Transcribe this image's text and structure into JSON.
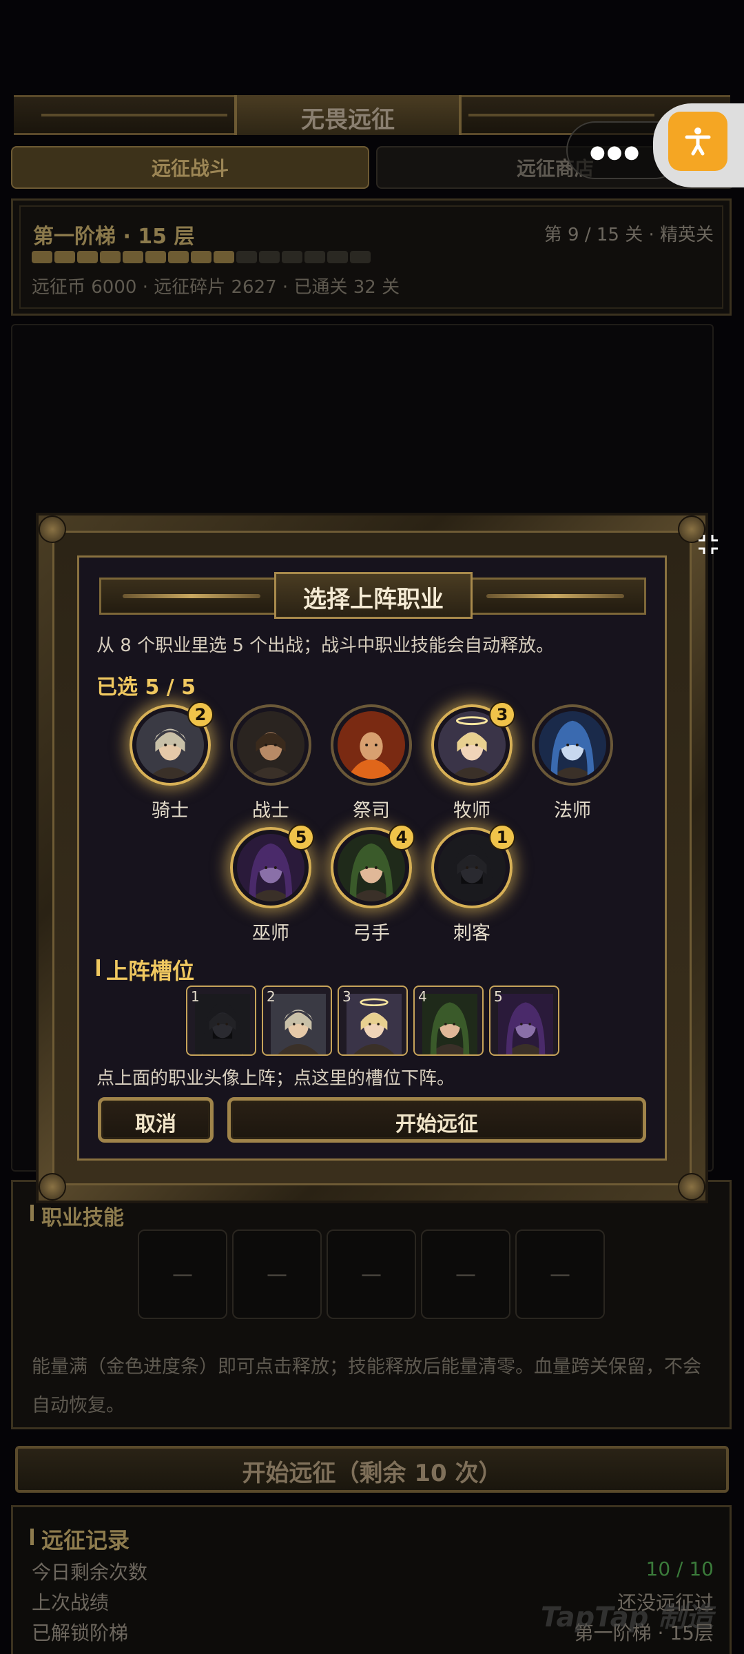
{
  "header": {
    "title": "无畏远征"
  },
  "tabs": [
    {
      "label": "远征战斗"
    },
    {
      "label": "远征商店"
    }
  ],
  "tier": {
    "title": "第一阶梯 · 15 层",
    "stage": "第 9 / 15 关 · 精英关",
    "progress_total": 15,
    "progress_done": 9,
    "meta": "远征币 6000 · 远征碎片 2627 · 已通关 32 关"
  },
  "skills": {
    "heading": "职业技能",
    "slots": [
      "—",
      "—",
      "—",
      "—",
      "—"
    ],
    "description": "能量满（金色进度条）即可点击释放；技能释放后能量清零。血量跨关保留，不会自动恢复。"
  },
  "start_button": {
    "label": "开始远征（剩余 10 次）"
  },
  "records": {
    "heading": "远征记录",
    "rows": [
      {
        "label": "今日剩余次数",
        "value": "10 / 10"
      },
      {
        "label": "上次战绩",
        "value": "还没远征过"
      },
      {
        "label": "已解锁阶梯",
        "value": "第一阶梯 · 15层"
      }
    ]
  },
  "watermark": "TapTap 制造",
  "modal": {
    "title": "选择上阵职业",
    "description": "从 8 个职业里选 5 个出战；战斗中职业技能会自动释放。",
    "selected_label": "已选 5 / 5",
    "classes": [
      {
        "name": "骑士",
        "order": "2",
        "selected": true
      },
      {
        "name": "战士",
        "order": "",
        "selected": false
      },
      {
        "name": "祭司",
        "order": "",
        "selected": false
      },
      {
        "name": "牧师",
        "order": "3",
        "selected": true
      },
      {
        "name": "法师",
        "order": "",
        "selected": false
      },
      {
        "name": "巫师",
        "order": "5",
        "selected": true
      },
      {
        "name": "弓手",
        "order": "4",
        "selected": true
      },
      {
        "name": "刺客",
        "order": "1",
        "selected": true
      }
    ],
    "slots_heading": "上阵槽位",
    "slots": [
      {
        "num": "1",
        "class": "刺客"
      },
      {
        "num": "2",
        "class": "骑士"
      },
      {
        "num": "3",
        "class": "牧师"
      },
      {
        "num": "4",
        "class": "弓手"
      },
      {
        "num": "5",
        "class": "巫师"
      }
    ],
    "hint": "点上面的职业头像上阵；点这里的槽位下阵。",
    "cancel_label": "取消",
    "confirm_label": "开始远征"
  },
  "colors": {
    "accent_gold": "#f0c860",
    "a11y_orange": "#f5a623",
    "record_value_green": "#3a7a3a"
  }
}
